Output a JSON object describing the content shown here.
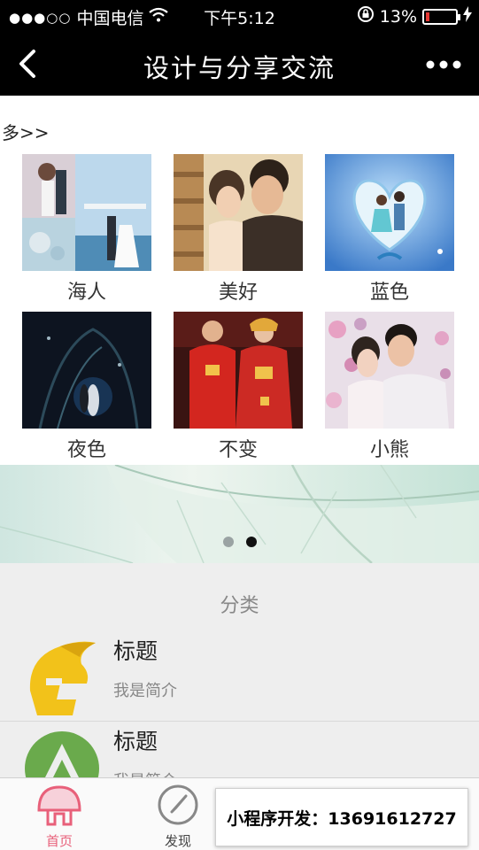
{
  "status": {
    "carrier": "中国电信",
    "time": "下午5:12",
    "battery": "13%",
    "battery_level": 0.13
  },
  "nav": {
    "title": "设计与分享交流"
  },
  "more_link": "多>>",
  "gallery": [
    {
      "caption": "海人"
    },
    {
      "caption": "美好"
    },
    {
      "caption": "蓝色"
    },
    {
      "caption": "夜色"
    },
    {
      "caption": "不变"
    },
    {
      "caption": "小熊"
    }
  ],
  "category": {
    "title": "分类",
    "items": [
      {
        "title": "标题",
        "subtitle": "我是简介"
      },
      {
        "title": "标题",
        "subtitle": "我是简介"
      }
    ]
  },
  "tabs": [
    {
      "label": "首页",
      "active": true
    },
    {
      "label": "发现",
      "active": false
    }
  ],
  "promo": "小程序开发：13691612727",
  "colors": {
    "accent": "#e8607a",
    "navbar": "#000000",
    "battery_low": "#e53935"
  }
}
